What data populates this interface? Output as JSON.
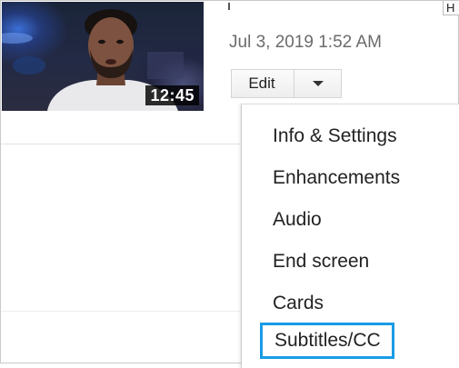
{
  "video": {
    "duration": "12:45",
    "timestamp": "Jul 3, 2019 1:52 AM"
  },
  "corner_button_label": "H",
  "edit_control": {
    "label": "Edit",
    "dropdown_icon": "caret-down-icon"
  },
  "dropdown_menu": {
    "items": [
      {
        "label": "Info & Settings"
      },
      {
        "label": "Enhancements"
      },
      {
        "label": "Audio"
      },
      {
        "label": "End screen"
      },
      {
        "label": "Cards"
      },
      {
        "label": "Subtitles/CC",
        "highlighted": true
      }
    ]
  },
  "colors": {
    "highlight_border": "#1a9be6",
    "timestamp_text": "#6b6b6b",
    "duration_badge": "#000000"
  }
}
